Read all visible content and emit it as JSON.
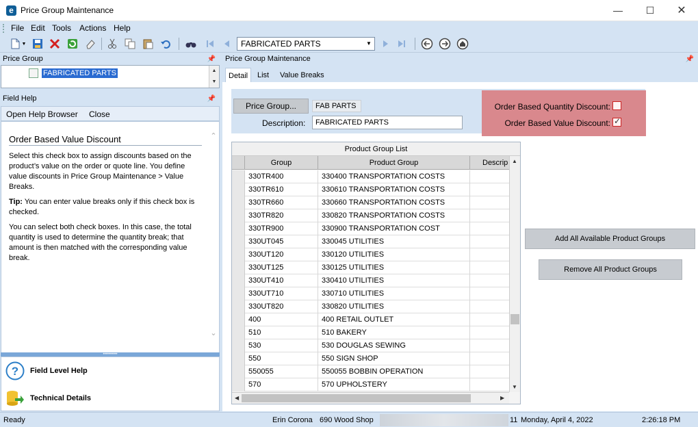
{
  "window": {
    "title": "Price Group Maintenance",
    "app_icon_letter": "e"
  },
  "menu": [
    "File",
    "Edit",
    "Tools",
    "Actions",
    "Help"
  ],
  "toolbar": {
    "selected_record": "FABRICATED PARTS"
  },
  "left": {
    "price_group_header": "Price Group",
    "tree_item": "FABRICATED PARTS",
    "field_help_header": "Field Help",
    "open_help_browser": "Open Help Browser",
    "close": "Close",
    "help_title": "Order Based Value Discount",
    "help_p1": "Select this check box to assign discounts based on the product’s value on the order or quote line.  You define value discounts in Price Group Maintenance > Value Breaks.",
    "help_tip_label": "Tip:",
    "help_tip": " You can enter value breaks only if this check box is checked.",
    "help_p3": "You can select both check boxes.  In this case, the total quantity is used to determine the quantity break; that amount is then matched with the corresponding value break.",
    "field_level_help": "Field Level Help",
    "technical_details": "Technical Details"
  },
  "main": {
    "header": "Price Group Maintenance",
    "tabs": [
      "Detail",
      "List",
      "Value Breaks"
    ],
    "price_group_button": "Price Group...",
    "price_group_code": "FAB PARTS",
    "description_label": "Description:",
    "description_value": "FABRICATED PARTS",
    "qty_discount_label": "Order Based Quantity Discount:",
    "value_discount_label": "Order Based Value Discount:",
    "qty_discount_checked": false,
    "value_discount_checked": true,
    "grid": {
      "caption": "Product Group List",
      "columns": [
        "Group",
        "Product Group",
        "Descrip"
      ],
      "rows": [
        [
          "330TR400",
          "330400 TRANSPORTATION COSTS"
        ],
        [
          "330TR610",
          "330610 TRANSPORTATION COSTS"
        ],
        [
          "330TR660",
          "330660 TRANSPORTATION COSTS"
        ],
        [
          "330TR820",
          "330820 TRANSPORTATION COSTS"
        ],
        [
          "330TR900",
          "330900 TRANSPORTATION COST"
        ],
        [
          "330UT045",
          "330045 UTILITIES"
        ],
        [
          "330UT120",
          "330120 UTILITIES"
        ],
        [
          "330UT125",
          "330125 UTILITIES"
        ],
        [
          "330UT410",
          "330410 UTILITIES"
        ],
        [
          "330UT710",
          "330710 UTILITIES"
        ],
        [
          "330UT820",
          "330820 UTILITIES"
        ],
        [
          "400",
          "400 RETAIL OUTLET"
        ],
        [
          "510",
          "510 BAKERY"
        ],
        [
          "530",
          "530 DOUGLAS SEWING"
        ],
        [
          "550",
          "550 SIGN SHOP"
        ],
        [
          "550055",
          "550055 BOBBIN OPERATION"
        ],
        [
          "570",
          "570 UPHOLSTERY"
        ]
      ]
    },
    "add_all_button": "Add All Available Product Groups",
    "remove_all_button": "Remove All Product Groups"
  },
  "status": {
    "ready": "Ready",
    "user": "Erin Corona",
    "company": "690 Wood Shop",
    "partial": "11",
    "date": "Monday, April 4, 2022",
    "time": "2:26:18 PM"
  }
}
